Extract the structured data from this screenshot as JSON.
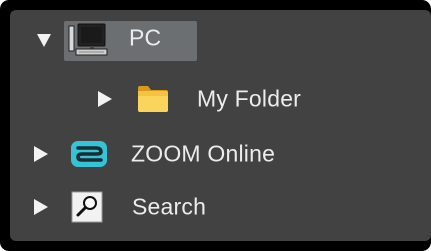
{
  "tree": {
    "items": [
      {
        "label": "PC",
        "icon": "computer-icon",
        "expanded": true,
        "selected": true
      },
      {
        "label": "My Folder",
        "icon": "folder-icon",
        "expanded": false,
        "selected": false
      },
      {
        "label": "ZOOM Online",
        "icon": "zoom-logo-icon",
        "expanded": false,
        "selected": false
      },
      {
        "label": "Search",
        "icon": "search-icon",
        "expanded": false,
        "selected": false
      }
    ]
  },
  "colors": {
    "panel_background": "#424242",
    "selection": "#6b6f72",
    "text": "#ececec",
    "folder": "#f5c242",
    "zoom_accent": "#35c3d6"
  }
}
